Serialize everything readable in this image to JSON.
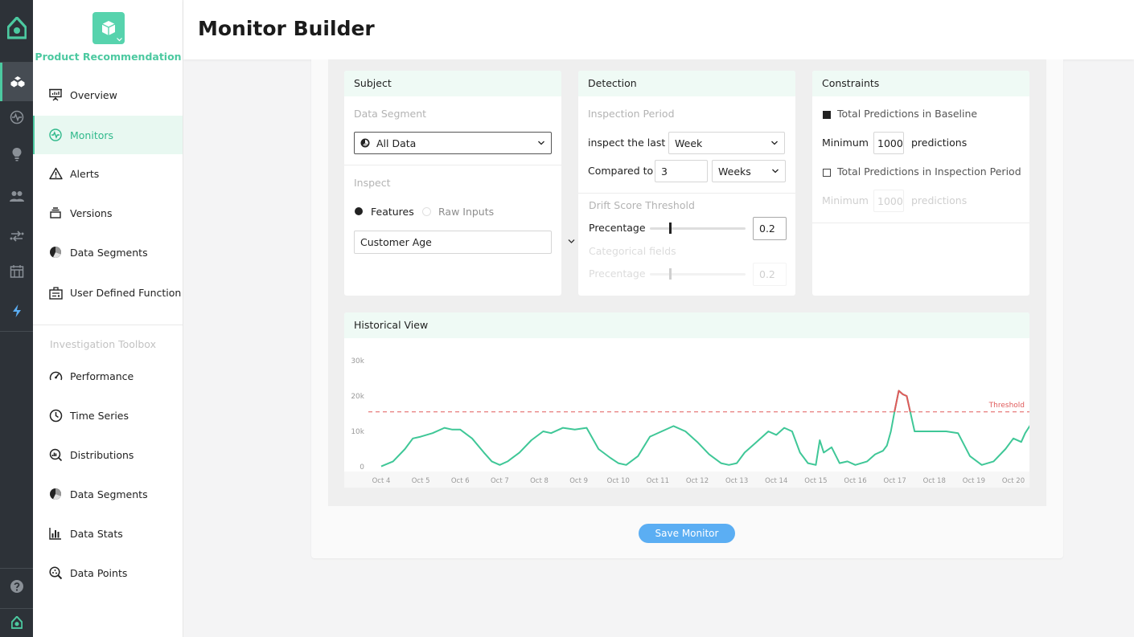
{
  "header": {
    "title": "Monitor Builder"
  },
  "project": {
    "name": "Product Recommendation"
  },
  "sidebar": {
    "items": [
      {
        "label": "Overview",
        "icon": "presentation-icon"
      },
      {
        "label": "Monitors",
        "icon": "monitor-pulse-icon",
        "active": true
      },
      {
        "label": "Alerts",
        "icon": "warning-triangle-icon"
      },
      {
        "label": "Versions",
        "icon": "stack-icon"
      },
      {
        "label": "Data Segments",
        "icon": "pie-chart-icon"
      },
      {
        "label": "User Defined Function",
        "icon": "function-icon"
      }
    ],
    "toolbox_title": "Investigation Toolbox",
    "toolbox": [
      {
        "label": "Performance",
        "icon": "gauge-icon"
      },
      {
        "label": "Time Series",
        "icon": "clock-icon"
      },
      {
        "label": "Distributions",
        "icon": "distribution-icon"
      },
      {
        "label": "Data Segments",
        "icon": "pie-chart-icon"
      },
      {
        "label": "Data Stats",
        "icon": "bar-chart-icon"
      },
      {
        "label": "Data Points",
        "icon": "magnifier-points-icon"
      }
    ]
  },
  "subject": {
    "title": "Subject",
    "segment_label": "Data Segment",
    "segment_value": "All Data",
    "inspect_label": "Inspect",
    "radio_features": "Features",
    "radio_raw": "Raw Inputs",
    "feature_value": "Customer Age"
  },
  "detection": {
    "title": "Detection",
    "period_label": "Inspection Period",
    "inspect_last_label": "inspect the last",
    "inspect_last_value": "Week",
    "compared_label": "Compared to",
    "compared_num": "3",
    "compared_unit": "Weeks",
    "drift_label": "Drift Score Threshold",
    "percentage_label": "Precentage",
    "percentage_value": "0.2",
    "percentage_slider": 0.2,
    "categorical_label": "Categorical fields",
    "cat_percentage_label": "Precentage",
    "cat_percentage_value": "0.2",
    "cat_percentage_slider": 0.2
  },
  "constraints": {
    "title": "Constraints",
    "baseline_label": "Total Predictions in Baseline",
    "baseline_checked": true,
    "min_label": "Minimum",
    "min_value": "1000",
    "predictions_label": "predictions",
    "inspection_label": "Total Predictions in Inspection Period",
    "inspection_checked": false,
    "min2_label": "Minimum",
    "min2_value": "1000",
    "predictions2_label": "predictions"
  },
  "historical": {
    "title": "Historical View"
  },
  "save_label": "Save Monitor",
  "colors": {
    "accent": "#4cc9a0",
    "line": "#3fc797",
    "alert": "#e05a5a",
    "button": "#5baef3"
  },
  "chart_data": {
    "type": "line",
    "title": "",
    "ylim": [
      0,
      30000
    ],
    "yticks": [
      0,
      10000,
      20000,
      30000
    ],
    "ytick_labels": [
      "0",
      "10k",
      "20k",
      "30k"
    ],
    "xtick_labels": [
      "Oct 4",
      "Oct 5",
      "Oct 6",
      "Oct 7",
      "Oct 8",
      "Oct 9",
      "Oct 10",
      "Oct 11",
      "Oct 12",
      "Oct 13",
      "Oct 14",
      "Oct 15",
      "Oct 16",
      "Oct 17",
      "Oct 18",
      "Oct 19",
      "Oct 20"
    ],
    "threshold": 15500,
    "threshold_label": "Threshold",
    "series": [
      {
        "x": [
          4.0,
          4.3,
          4.6,
          4.8,
          5.0,
          5.3,
          5.6,
          5.8,
          6.0,
          6.3,
          6.6,
          6.8,
          7.0,
          7.2,
          7.5,
          7.8,
          8.1,
          8.3,
          8.6,
          8.9,
          9.2,
          9.5,
          9.8,
          10.0,
          10.2,
          10.5,
          10.8,
          11.1,
          11.4,
          11.7,
          12.0,
          12.3,
          12.6,
          12.8,
          13.0,
          13.2,
          13.5,
          13.8,
          14.0,
          14.2,
          14.4,
          14.6,
          14.8,
          15.0,
          15.1,
          15.2,
          15.4,
          15.6,
          15.8,
          16.0,
          16.3,
          16.5,
          16.7,
          16.8,
          16.9,
          17.0,
          17.1,
          17.2,
          17.3,
          17.5,
          17.7,
          18.0,
          18.3,
          18.6,
          18.9,
          19.2,
          19.5,
          19.8,
          20.0,
          20.2,
          20.3,
          20.5,
          20.7,
          21.0
        ],
        "y": [
          100,
          1500,
          5000,
          8000,
          8500,
          9500,
          11000,
          10500,
          10500,
          8000,
          4000,
          1500,
          500,
          1500,
          4000,
          7500,
          10000,
          9500,
          11000,
          10500,
          11000,
          5000,
          2500,
          1000,
          500,
          3000,
          8500,
          10000,
          11500,
          10000,
          7000,
          3500,
          1000,
          500,
          1000,
          4000,
          7000,
          10000,
          9000,
          11000,
          10000,
          4000,
          1000,
          500,
          7500,
          4000,
          5500,
          1000,
          1500,
          500,
          1500,
          3500,
          4500,
          6000,
          10000,
          16000,
          21500,
          20500,
          20000,
          10000,
          10000,
          10000,
          10000,
          9500,
          3000,
          500,
          1500,
          5000,
          8000,
          7000,
          9500,
          13000,
          10000,
          10000
        ]
      }
    ]
  }
}
